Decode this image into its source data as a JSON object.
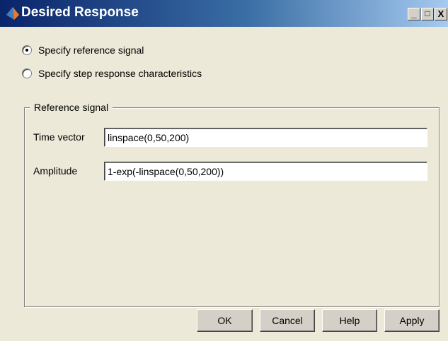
{
  "window": {
    "title": "Desired Response",
    "title_icon": "matlab-icon",
    "controls": {
      "minimize": "_",
      "maximize": "□",
      "close": "X"
    }
  },
  "mode_options": [
    {
      "label": "Specify reference signal",
      "checked": true
    },
    {
      "label": "Specify step response characteristics",
      "checked": false
    }
  ],
  "reference_signal": {
    "legend": "Reference signal",
    "time_vector": {
      "label": "Time vector",
      "value": "linspace(0,50,200)"
    },
    "amplitude": {
      "label": "Amplitude",
      "value": "1-exp(-linspace(0,50,200))"
    }
  },
  "buttons": {
    "ok": "OK",
    "cancel": "Cancel",
    "help": "Help",
    "apply": "Apply"
  }
}
